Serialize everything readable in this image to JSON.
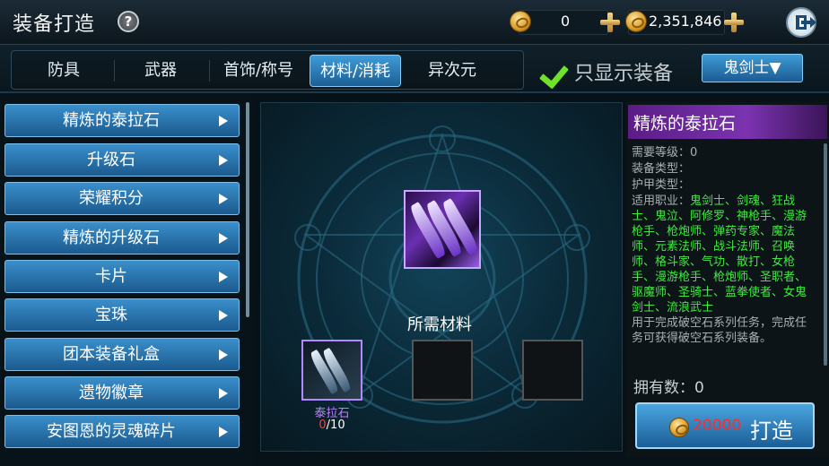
{
  "header": {
    "title": "装备打造",
    "help_icon": "?",
    "currency1_value": "0",
    "currency2_value": "2,351,846"
  },
  "tabs": [
    {
      "label": "防具"
    },
    {
      "label": "武器"
    },
    {
      "label": "首饰/称号"
    },
    {
      "label": "材料/消耗",
      "active": true
    },
    {
      "label": "异次元"
    }
  ],
  "filter": {
    "only_equip_label": "只显示装备",
    "class_select": "鬼剑士▼"
  },
  "categories": [
    {
      "label": "精炼的泰拉石"
    },
    {
      "label": "升级石"
    },
    {
      "label": "荣耀积分"
    },
    {
      "label": "精炼的升级石"
    },
    {
      "label": "卡片"
    },
    {
      "label": "宝珠"
    },
    {
      "label": "团本装备礼盒"
    },
    {
      "label": "遗物徽章"
    },
    {
      "label": "安图恩的灵魂碎片"
    }
  ],
  "crafting": {
    "required_label": "所需材料",
    "material_name": "泰拉石",
    "material_have": "0",
    "material_need": "/10"
  },
  "detail": {
    "name": "精炼的泰拉石",
    "level": "需要等级：0",
    "equip_type": "装备类型：",
    "armor_type": "护甲类型：",
    "jobs_prefix": "适用职业：",
    "jobs": "鬼剑士、剑魂、狂战士、鬼泣、阿修罗、神枪手、漫游枪手、枪炮师、弹药专家、魔法师、元素法师、战斗法师、召唤师、格斗家、气功、散打、女枪手、漫游枪手、枪炮师、圣职者、驱魔师、圣骑士、蓝拳使者、女鬼剑士、流浪武士",
    "description": "用于完成破空石系列任务，完成任务可获得破空石系列装备。",
    "owned": "拥有数：0"
  },
  "craft_button": {
    "cost": "20000",
    "label": "打造"
  },
  "colors": {
    "accent_blue": "#2f7fbf",
    "header_purple": "#6b2a9c",
    "job_green": "#3eea3e",
    "cost_red": "#ff2c2c"
  }
}
